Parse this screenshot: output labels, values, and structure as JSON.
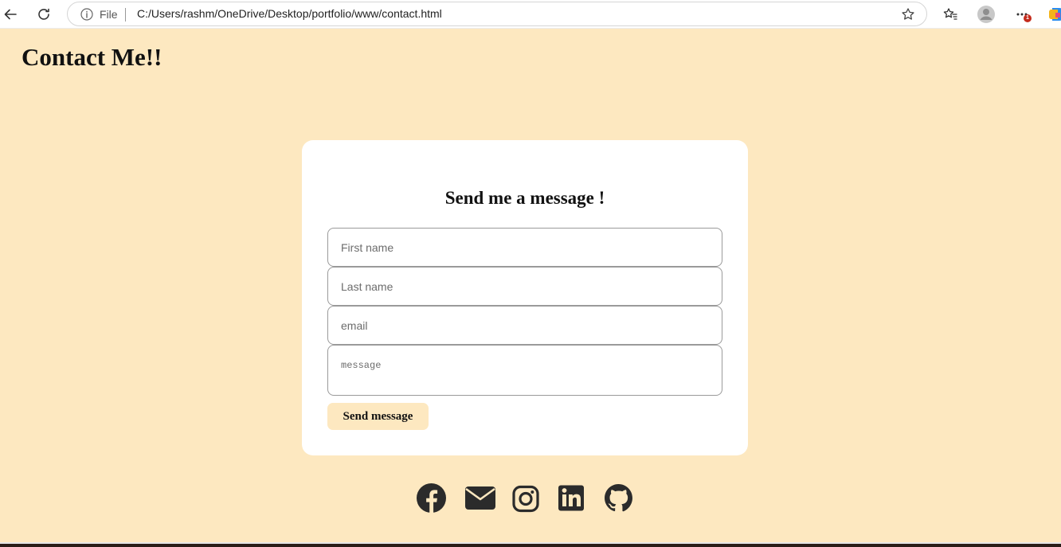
{
  "browser": {
    "file_label": "File",
    "url": "C:/Users/rashm/OneDrive/Desktop/portfolio/www/contact.html",
    "notification_count": "1"
  },
  "page": {
    "title": "Contact Me!!"
  },
  "form": {
    "heading": "Send me a message !",
    "first_name_placeholder": "First name",
    "last_name_placeholder": "Last name",
    "email_placeholder": "email",
    "message_placeholder": "message",
    "submit_label": "Send message"
  },
  "social": [
    "facebook-icon",
    "mail-icon",
    "instagram-icon",
    "linkedin-icon",
    "github-icon"
  ],
  "colors": {
    "page_background": "#fde8c0",
    "card_background": "#ffffff",
    "button_background": "#fde8c0",
    "icon_color": "#2b2b2b"
  }
}
